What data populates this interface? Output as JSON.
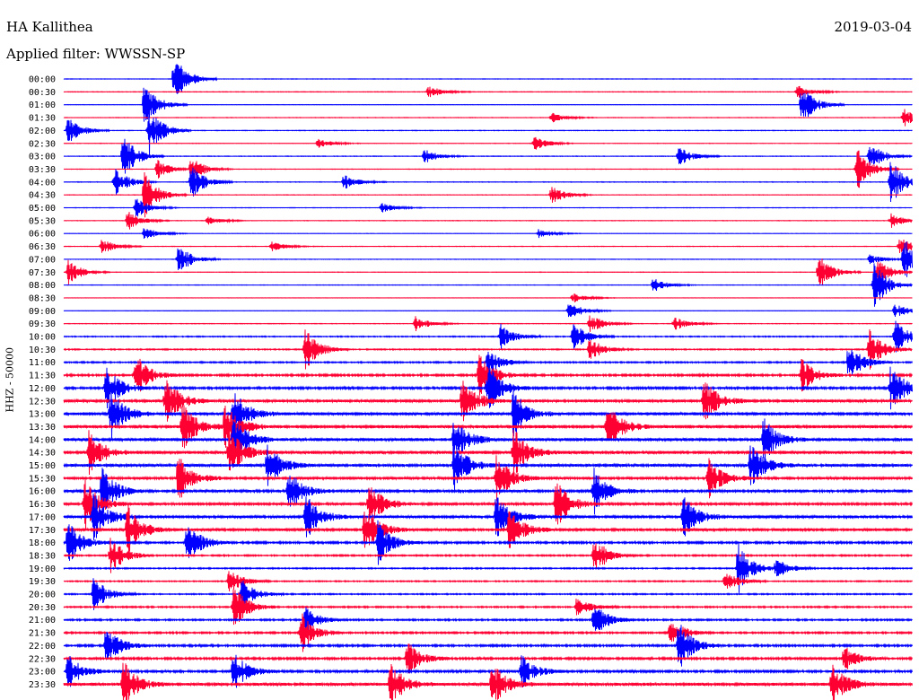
{
  "header": {
    "station": "HA Kallithea",
    "date": "2019-03-04",
    "filter_label": "Applied filter: WWSSN-SP"
  },
  "chart_data": {
    "type": "line",
    "ylabel": "HHZ - 50000",
    "colors": [
      "#0000ff",
      "#ff0033"
    ],
    "traces": [
      {
        "time": "00:00",
        "noise": 0.08,
        "events": [
          [
            13.0,
            1.0
          ]
        ]
      },
      {
        "time": "00:30",
        "noise": 0.1,
        "events": [
          [
            43.0,
            0.25
          ],
          [
            86.5,
            0.3
          ]
        ]
      },
      {
        "time": "01:00",
        "noise": 0.08,
        "events": [
          [
            9.5,
            1.0
          ],
          [
            87.0,
            0.8
          ]
        ]
      },
      {
        "time": "01:30",
        "noise": 0.08,
        "events": [
          [
            57.5,
            0.2
          ],
          [
            99.0,
            0.4
          ]
        ]
      },
      {
        "time": "02:00",
        "noise": 0.1,
        "events": [
          [
            0.5,
            0.6
          ],
          [
            10.0,
            1.0
          ]
        ]
      },
      {
        "time": "02:30",
        "noise": 0.08,
        "events": [
          [
            30.0,
            0.2
          ],
          [
            55.5,
            0.3
          ]
        ]
      },
      {
        "time": "03:00",
        "noise": 0.1,
        "events": [
          [
            7.0,
            0.9
          ],
          [
            42.5,
            0.3
          ],
          [
            72.5,
            0.4
          ],
          [
            95.0,
            0.6
          ]
        ]
      },
      {
        "time": "03:30",
        "noise": 0.08,
        "events": [
          [
            11.0,
            0.4
          ],
          [
            15.0,
            0.5
          ],
          [
            93.5,
            0.9
          ]
        ]
      },
      {
        "time": "04:00",
        "noise": 0.1,
        "events": [
          [
            6.0,
            0.6
          ],
          [
            15.0,
            0.7
          ],
          [
            33.0,
            0.3
          ],
          [
            97.5,
            1.0
          ]
        ]
      },
      {
        "time": "04:30",
        "noise": 0.08,
        "events": [
          [
            9.5,
            0.9
          ],
          [
            57.5,
            0.4
          ]
        ]
      },
      {
        "time": "05:00",
        "noise": 0.08,
        "events": [
          [
            8.5,
            0.4
          ],
          [
            37.5,
            0.2
          ]
        ]
      },
      {
        "time": "05:30",
        "noise": 0.08,
        "events": [
          [
            7.5,
            0.4
          ],
          [
            17.0,
            0.2
          ],
          [
            97.5,
            0.3
          ]
        ]
      },
      {
        "time": "06:00",
        "noise": 0.06,
        "events": [
          [
            9.5,
            0.3
          ],
          [
            56.0,
            0.2
          ]
        ]
      },
      {
        "time": "06:30",
        "noise": 0.08,
        "events": [
          [
            4.5,
            0.3
          ],
          [
            24.5,
            0.2
          ],
          [
            98.5,
            0.4
          ]
        ]
      },
      {
        "time": "07:00",
        "noise": 0.08,
        "events": [
          [
            13.5,
            0.6
          ],
          [
            95.0,
            0.2
          ],
          [
            99.0,
            0.9
          ]
        ]
      },
      {
        "time": "07:30",
        "noise": 0.08,
        "events": [
          [
            0.5,
            0.5
          ],
          [
            89.0,
            0.7
          ],
          [
            96.0,
            0.6
          ]
        ]
      },
      {
        "time": "08:00",
        "noise": 0.08,
        "events": [
          [
            69.5,
            0.3
          ],
          [
            95.5,
            1.0
          ]
        ]
      },
      {
        "time": "08:30",
        "noise": 0.06,
        "events": [
          [
            60.0,
            0.2
          ]
        ]
      },
      {
        "time": "09:00",
        "noise": 0.08,
        "events": [
          [
            59.5,
            0.4
          ],
          [
            98.0,
            0.3
          ]
        ]
      },
      {
        "time": "09:30",
        "noise": 0.1,
        "events": [
          [
            41.5,
            0.3
          ],
          [
            62.0,
            0.4
          ],
          [
            72.0,
            0.3
          ]
        ]
      },
      {
        "time": "10:00",
        "noise": 0.18,
        "events": [
          [
            51.5,
            0.5
          ],
          [
            60.0,
            0.6
          ],
          [
            98.0,
            0.7
          ]
        ]
      },
      {
        "time": "10:30",
        "noise": 0.2,
        "events": [
          [
            28.5,
            0.9
          ],
          [
            62.0,
            0.5
          ],
          [
            95.0,
            0.8
          ]
        ]
      },
      {
        "time": "11:00",
        "noise": 0.25,
        "events": [
          [
            50.0,
            0.5
          ],
          [
            92.5,
            0.8
          ]
        ]
      },
      {
        "time": "11:30",
        "noise": 0.35,
        "events": [
          [
            8.5,
            0.9
          ],
          [
            49.0,
            0.9
          ],
          [
            87.0,
            0.7
          ]
        ]
      },
      {
        "time": "12:00",
        "noise": 0.4,
        "events": [
          [
            5.0,
            0.9
          ],
          [
            50.0,
            1.0
          ],
          [
            97.5,
            1.0
          ]
        ]
      },
      {
        "time": "12:30",
        "noise": 0.5,
        "events": [
          [
            12.0,
            1.0
          ],
          [
            47.0,
            1.0
          ],
          [
            75.5,
            0.9
          ]
        ]
      },
      {
        "time": "13:00",
        "noise": 0.55,
        "events": [
          [
            5.5,
            1.0
          ],
          [
            20.0,
            1.0
          ],
          [
            53.0,
            1.0
          ]
        ]
      },
      {
        "time": "13:30",
        "noise": 0.6,
        "events": [
          [
            14.0,
            1.0
          ],
          [
            19.0,
            1.0
          ],
          [
            64.0,
            1.0
          ]
        ]
      },
      {
        "time": "14:00",
        "noise": 0.55,
        "events": [
          [
            20.0,
            1.0
          ],
          [
            46.0,
            0.9
          ],
          [
            82.5,
            0.9
          ]
        ]
      },
      {
        "time": "14:30",
        "noise": 0.6,
        "events": [
          [
            3.0,
            1.0
          ],
          [
            19.5,
            1.0
          ],
          [
            53.0,
            1.0
          ]
        ]
      },
      {
        "time": "15:00",
        "noise": 0.5,
        "events": [
          [
            24.0,
            0.9
          ],
          [
            46.0,
            1.0
          ],
          [
            81.0,
            0.9
          ]
        ]
      },
      {
        "time": "15:30",
        "noise": 0.45,
        "events": [
          [
            13.5,
            1.0
          ],
          [
            51.0,
            1.0
          ],
          [
            76.0,
            0.9
          ]
        ]
      },
      {
        "time": "16:00",
        "noise": 0.45,
        "events": [
          [
            4.5,
            1.0
          ],
          [
            26.5,
            0.9
          ],
          [
            62.5,
            0.9
          ]
        ]
      },
      {
        "time": "16:30",
        "noise": 0.45,
        "events": [
          [
            2.5,
            1.0
          ],
          [
            36.0,
            1.0
          ],
          [
            58.0,
            1.0
          ]
        ]
      },
      {
        "time": "17:00",
        "noise": 0.5,
        "events": [
          [
            3.5,
            1.0
          ],
          [
            28.5,
            1.0
          ],
          [
            51.0,
            1.0
          ],
          [
            73.0,
            1.0
          ]
        ]
      },
      {
        "time": "17:30",
        "noise": 0.5,
        "events": [
          [
            7.5,
            1.0
          ],
          [
            35.5,
            1.0
          ],
          [
            52.5,
            0.9
          ]
        ]
      },
      {
        "time": "18:00",
        "noise": 0.35,
        "events": [
          [
            0.5,
            0.9
          ],
          [
            14.5,
            0.9
          ],
          [
            37.0,
            0.9
          ]
        ]
      },
      {
        "time": "18:30",
        "noise": 0.25,
        "events": [
          [
            5.5,
            0.8
          ],
          [
            62.5,
            0.8
          ]
        ]
      },
      {
        "time": "19:00",
        "noise": 0.22,
        "events": [
          [
            79.5,
            1.0
          ],
          [
            84.0,
            0.4
          ]
        ]
      },
      {
        "time": "19:30",
        "noise": 0.2,
        "events": [
          [
            19.5,
            0.5
          ],
          [
            78.0,
            0.4
          ]
        ]
      },
      {
        "time": "20:00",
        "noise": 0.22,
        "events": [
          [
            3.5,
            0.7
          ],
          [
            21.0,
            0.6
          ]
        ]
      },
      {
        "time": "20:30",
        "noise": 0.25,
        "events": [
          [
            20.0,
            0.9
          ],
          [
            60.5,
            0.4
          ]
        ]
      },
      {
        "time": "21:00",
        "noise": 0.28,
        "events": [
          [
            28.5,
            0.5
          ],
          [
            62.5,
            0.7
          ]
        ]
      },
      {
        "time": "21:30",
        "noise": 0.3,
        "events": [
          [
            28.0,
            0.8
          ],
          [
            71.5,
            0.6
          ]
        ]
      },
      {
        "time": "22:00",
        "noise": 0.35,
        "events": [
          [
            5.0,
            0.8
          ],
          [
            72.5,
            1.0
          ]
        ]
      },
      {
        "time": "22:30",
        "noise": 0.38,
        "events": [
          [
            40.5,
            0.7
          ],
          [
            92.0,
            0.5
          ]
        ]
      },
      {
        "time": "23:00",
        "noise": 0.4,
        "events": [
          [
            0.5,
            0.7
          ],
          [
            20.0,
            0.8
          ],
          [
            54.0,
            0.7
          ]
        ]
      },
      {
        "time": "23:30",
        "noise": 0.55,
        "events": [
          [
            7.0,
            1.0
          ],
          [
            38.5,
            0.9
          ],
          [
            50.5,
            0.9
          ],
          [
            90.5,
            0.9
          ]
        ]
      }
    ]
  }
}
